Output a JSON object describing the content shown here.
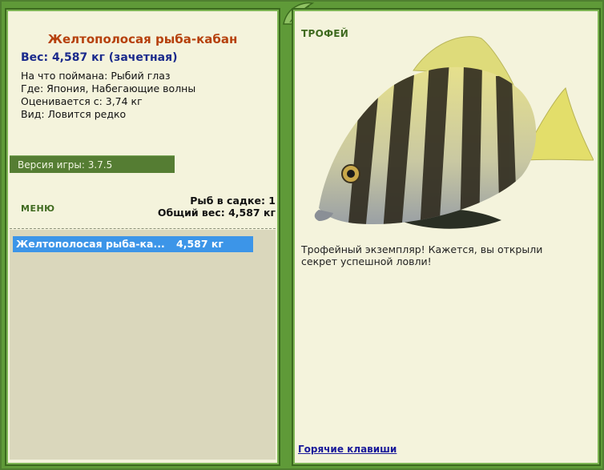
{
  "fish": {
    "title": "Желтополосая рыба-кабан",
    "weight": "Вес: 4,587 кг (зачетная)",
    "details": [
      "На что поймана: Рыбий глаз",
      "Где: Япония, Набегающие волны",
      "Оценивается с: 3,74 кг",
      "Вид: Ловится редко"
    ]
  },
  "version": "Версия игры: 3.7.5",
  "menu_label": "МЕНЮ",
  "stats": {
    "count": "Рыб в садке: 1",
    "total": "Общий вес: 4,587 кг"
  },
  "catch_list": [
    {
      "name": "Желтополосая рыба-ка...",
      "weight": "4,587 кг"
    }
  ],
  "trophy": {
    "label": "ТРОФЕЙ",
    "description": "Трофейный экземпляр! Кажется, вы открыли секрет успешной ловли!"
  },
  "hotkeys": "Горячие клавиши",
  "colors": {
    "frame": "#5f9a38",
    "panel_bg": "#f4f3dc",
    "title": "#b6410d",
    "weight": "#1a2a8c",
    "selected_row": "#3c95e8"
  }
}
